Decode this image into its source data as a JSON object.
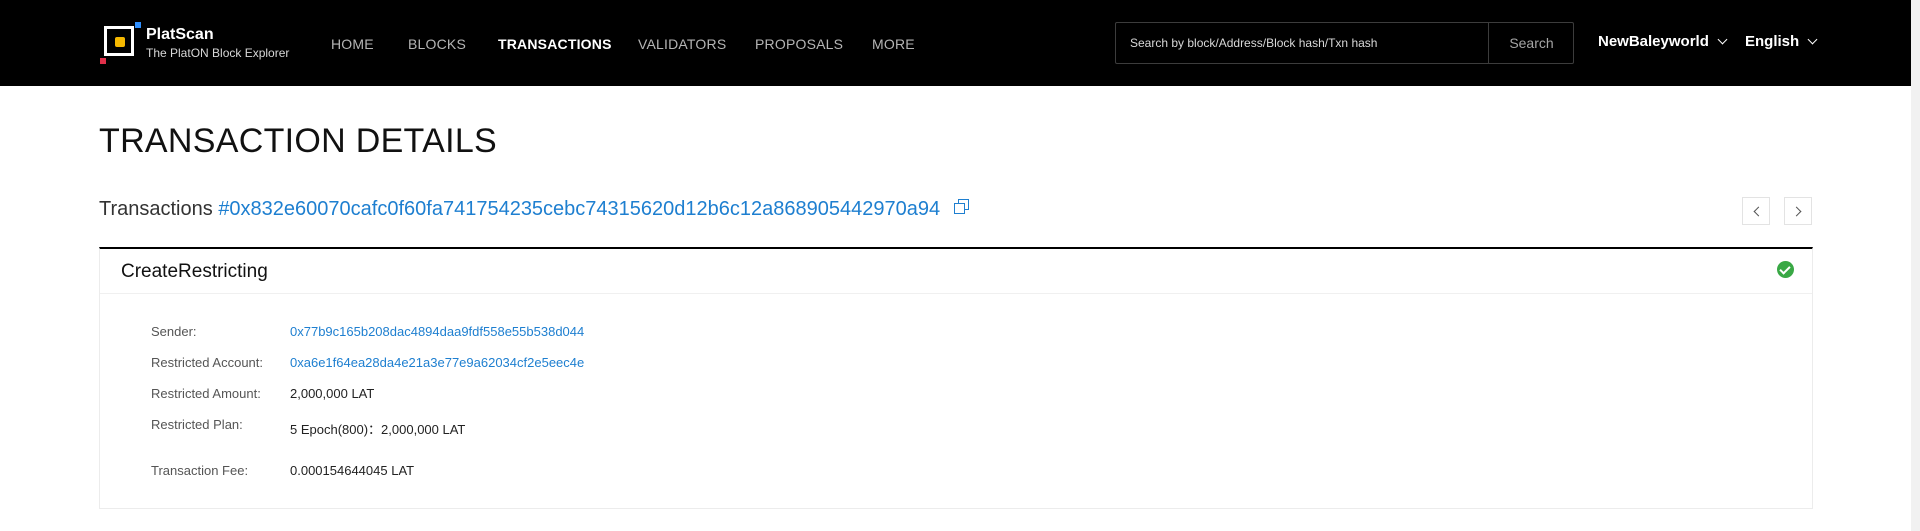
{
  "header": {
    "brand_name": "PlatScan",
    "brand_sub": "The PlatON Block Explorer",
    "nav": [
      "HOME",
      "BLOCKS",
      "TRANSACTIONS",
      "VALIDATORS",
      "PROPOSALS",
      "MORE"
    ],
    "active_nav": "TRANSACTIONS",
    "search_placeholder": "Search by block/Address/Block hash/Txn hash",
    "search_button": "Search",
    "network": "NewBaleyworld",
    "language": "English"
  },
  "page": {
    "title": "TRANSACTION DETAILS",
    "tx_prefix": "Transactions",
    "tx_hash": "#0x832e60070cafc0f60fa741754235cebc74315620d12b6c12a868905442970a94"
  },
  "card": {
    "type": "CreateRestricting",
    "status_icon": "success-check-icon",
    "fields": [
      {
        "label": "Sender:",
        "value": "0x77b9c165b208dac4894daa9fdf558e55b538d044",
        "link": true
      },
      {
        "label": "Restricted Account:",
        "value": "0xa6e1f64ea28da4e21a3e77e9a62034cf2e5eec4e",
        "link": true
      },
      {
        "label": "Restricted Amount:",
        "value": "2,000,000 LAT",
        "link": false
      },
      {
        "label": "Restricted Plan:",
        "value": "5 Epoch(800)：2,000,000 LAT",
        "link": false
      },
      {
        "label": "Transaction Fee:",
        "value": "0.000154644045 LAT",
        "link": false
      }
    ]
  },
  "colors": {
    "header_bg": "#000000",
    "link": "#1e7fd0",
    "success": "#39a845"
  }
}
